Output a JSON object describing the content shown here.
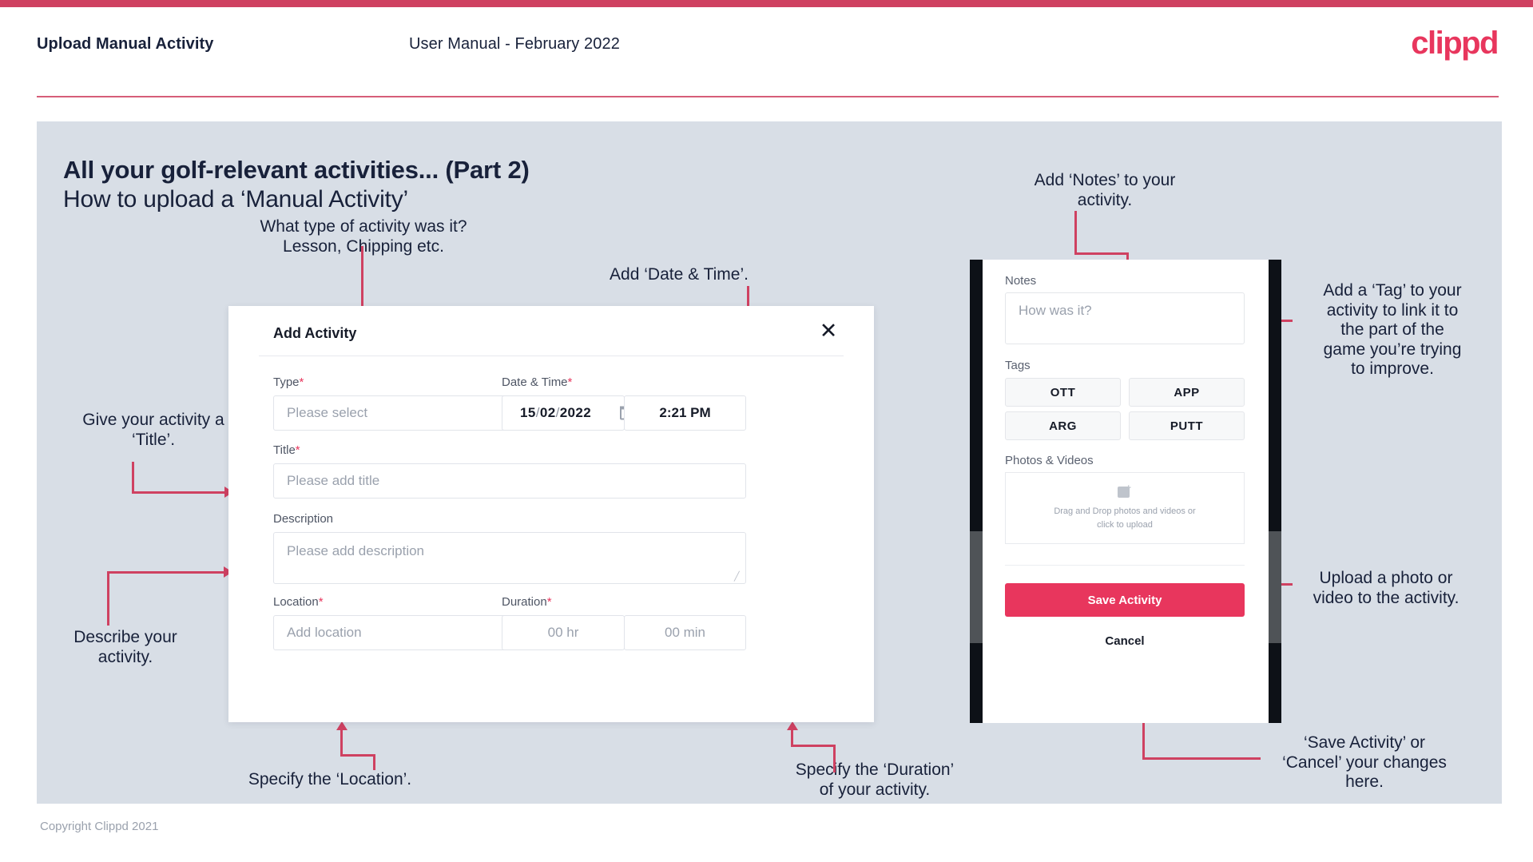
{
  "header": {
    "title": "Upload Manual Activity",
    "subtitle": "User Manual - February 2022",
    "logo": "clippd"
  },
  "slide": {
    "title": "All your golf-relevant activities... (Part 2)",
    "subtitle": "How to upload a ‘Manual Activity’"
  },
  "footer": {
    "copyright": "Copyright Clippd 2021"
  },
  "colors": {
    "accent": "#e8365d",
    "rule": "#cf4161",
    "panel": "#d8dee6",
    "text": "#18213a"
  },
  "dialog": {
    "title": "Add Activity",
    "close_icon": "close-icon",
    "fields": {
      "type": {
        "label": "Type",
        "required": "*",
        "placeholder": "Please select"
      },
      "datetime": {
        "label": "Date & Time",
        "required": "*",
        "day": "15",
        "month": "02",
        "year": "2022",
        "sep": "/",
        "time": "2:21 PM"
      },
      "title": {
        "label": "Title",
        "required": "*",
        "placeholder": "Please add title"
      },
      "description": {
        "label": "Description",
        "placeholder": "Please add description"
      },
      "location": {
        "label": "Location",
        "required": "*",
        "placeholder": "Add location"
      },
      "duration": {
        "label": "Duration",
        "required": "*",
        "hours": "00 hr",
        "minutes": "00 min"
      }
    }
  },
  "phone": {
    "notes": {
      "label": "Notes",
      "placeholder": "How was it?"
    },
    "tags": {
      "label": "Tags",
      "items": [
        "OTT",
        "APP",
        "ARG",
        "PUTT"
      ]
    },
    "photos": {
      "label": "Photos & Videos",
      "drop_line1": "Drag and Drop photos and videos or",
      "drop_line2": "click to upload",
      "icon": "image-plus-icon"
    },
    "save_label": "Save Activity",
    "cancel_label": "Cancel"
  },
  "annotations": {
    "type": "What type of activity was it?\nLesson, Chipping etc.",
    "datetime": "Add ‘Date & Time’.",
    "title": "Give your activity a\n‘Title’.",
    "description": "Describe your\nactivity.",
    "location": "Specify the ‘Location’.",
    "duration": "Specify the ‘Duration’\nof your activity.",
    "notes": "Add ‘Notes’ to your\nactivity.",
    "tags": "Add a ‘Tag’ to your\nactivity to link it to\nthe part of the\ngame you’re trying\nto improve.",
    "photos": "Upload a photo or\nvideo to the activity.",
    "save": "‘Save Activity’ or\n‘Cancel’ your changes\nhere."
  }
}
